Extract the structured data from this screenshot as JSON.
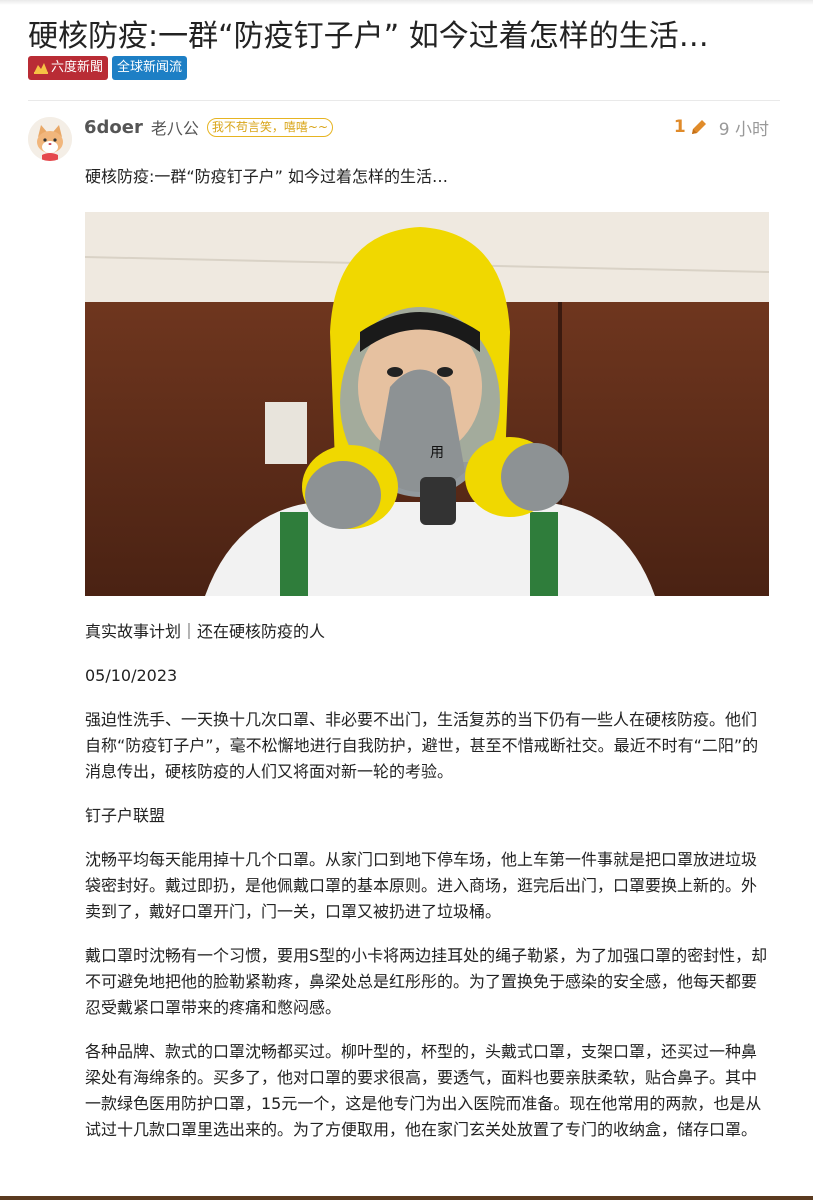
{
  "topic": {
    "title": "硬核防疫:一群“防疫钉子户” 如今过着怎样的生活…",
    "category": {
      "icon": "六度-logo-icon",
      "label": "六度新聞",
      "color": "#b92c35"
    },
    "tag": {
      "label": "全球新闻流",
      "color": "#1d7fc5"
    }
  },
  "post": {
    "username": "6doer",
    "full_name": "老八公",
    "flair": "我不苟言笑，嘻嘻~~",
    "edit_count": "1",
    "edit_icon": "pencil-icon",
    "age": "9 小时",
    "avatar_icon": "cat-avatar-icon",
    "lead": "硬核防疫:一群“防疫钉子户” 如今过着怎样的生活…",
    "image_icon": "gas-mask-photo",
    "paragraphs": [
      "真实故事计划｜还在硬核防疫的人",
      "05/10/2023",
      "强迫性洗手、一天换十几次口罩、非必要不出门，生活复苏的当下仍有一些人在硬核防疫。他们自称“防疫钉子户”，毫不松懈地进行自我防护，避世，甚至不惜戒断社交。最近不时有“二阳”的消息传出，硬核防疫的人们又将面对新一轮的考验。",
      "钉子户联盟",
      "沈畅平均每天能用掉十几个口罩。从家门口到地下停车场，他上车第一件事就是把口罩放进垃圾袋密封好。戴过即扔，是他佩戴口罩的基本原则。进入商场，逛完后出门，口罩要换上新的。外卖到了，戴好口罩开门，门一关，口罩又被扔进了垃圾桶。",
      "戴口罩时沈畅有一个习惯，要用S型的小卡将两边挂耳处的绳子勒紧，为了加强口罩的密封性，却不可避免地把他的脸勒紧勒疼，鼻梁处总是红彤彤的。为了置换免于感染的安全感，他每天都要忍受戴紧口罩带来的疼痛和憋闷感。",
      "各种品牌、款式的口罩沈畅都买过。柳叶型的，杯型的，头戴式口罩，支架口罩，还买过一种鼻梁处有海绵条的。买多了，他对口罩的要求很高，要透气，面料也要亲肤柔软，贴合鼻子。其中一款绿色医用防护口罩，15元一个，这是他专门为出入医院而准备。现在他常用的两款，也是从试过十几款口罩里选出来的。为了方便取用，他在家门玄关处放置了专门的收纳盒，储存口罩。"
    ]
  }
}
